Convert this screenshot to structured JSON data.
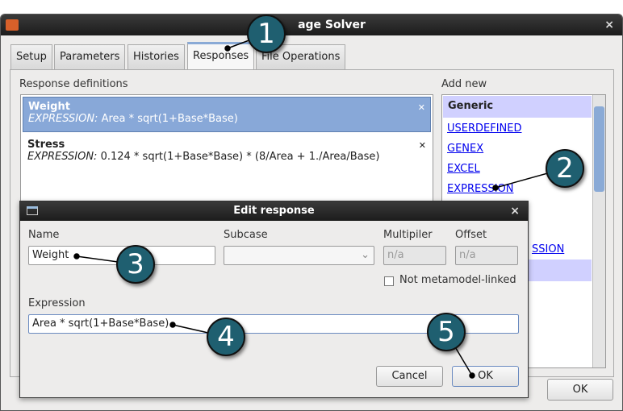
{
  "window": {
    "title": "Package Solver",
    "title_visible": "age Solver",
    "close": "×",
    "ok": "OK"
  },
  "tabs": [
    "Setup",
    "Parameters",
    "Histories",
    "Responses",
    "File Operations"
  ],
  "responses": {
    "label": "Response definitions",
    "items": [
      {
        "name": "Weight",
        "prefix": "EXPRESSION:",
        "expr": "Area * sqrt(1+Base*Base)"
      },
      {
        "name": "Stress",
        "prefix": "EXPRESSION:",
        "expr": "0.124 * sqrt(1+Base*Base) * (8/Area + 1./Area/Base)"
      }
    ]
  },
  "add_new": {
    "label": "Add new",
    "header": "Generic",
    "links": [
      "USERDEFINED",
      "GENEX",
      "EXCEL",
      "EXPRESSION"
    ],
    "partial_link": "SSION"
  },
  "dialog": {
    "title": "Edit response",
    "close": "×",
    "name_label": "Name",
    "name_value": "Weight",
    "subcase_label": "Subcase",
    "multiplier_label": "Multipiler",
    "multiplier_value": "n/a",
    "offset_label": "Offset",
    "offset_value": "n/a",
    "checkbox_label": "Not metamodel-linked",
    "expression_label": "Expression",
    "expression_value": "Area * sqrt(1+Base*Base)",
    "cancel": "Cancel",
    "ok": "OK"
  },
  "callouts": [
    "1",
    "2",
    "3",
    "4",
    "5"
  ],
  "colors": {
    "callout": "#1f5f70",
    "selection": "#88a8d8",
    "header_bg": "#d0d0ff"
  }
}
